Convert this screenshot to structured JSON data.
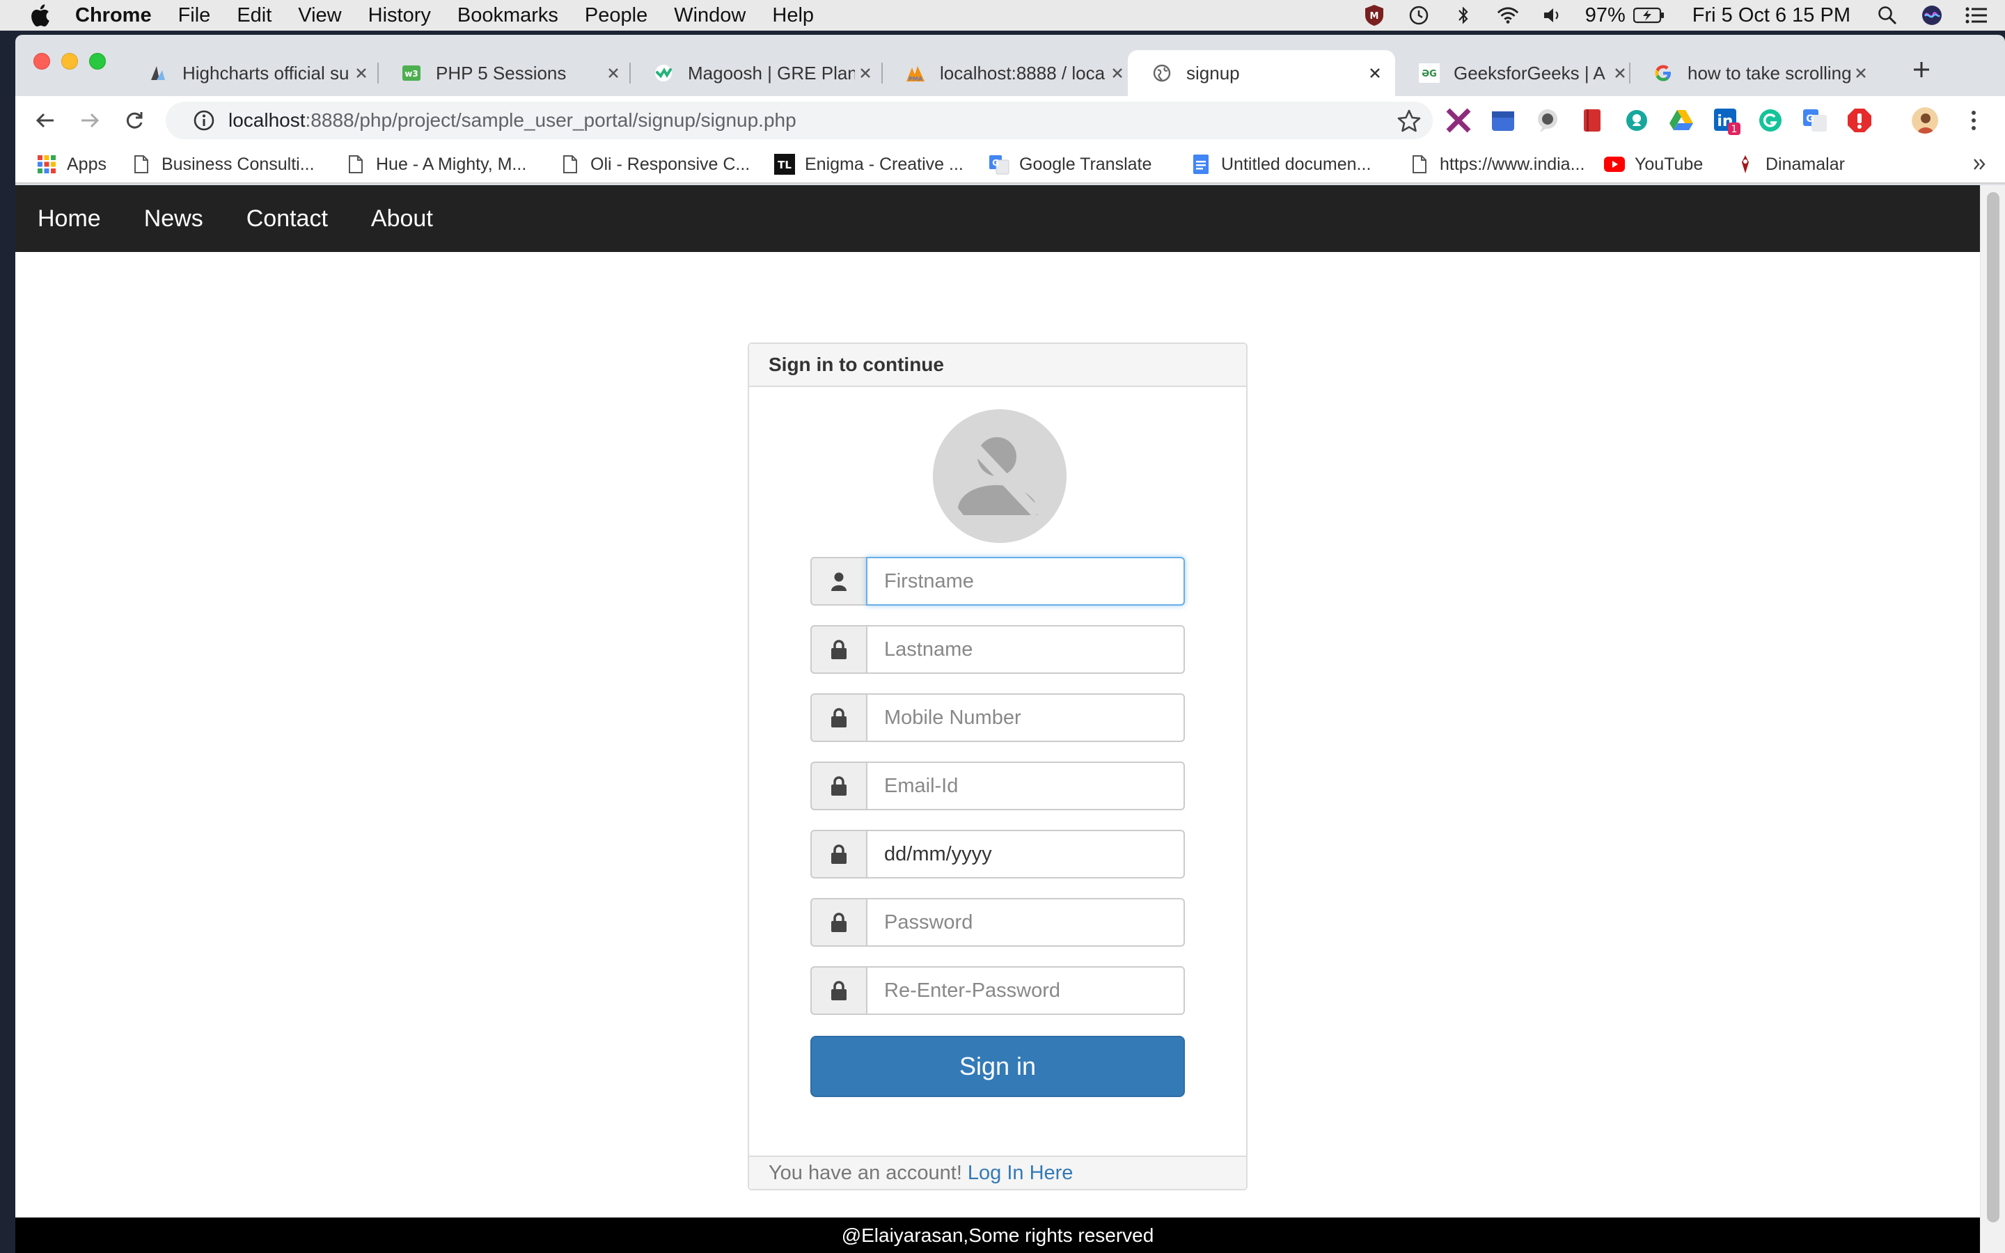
{
  "menubar": {
    "app": "Chrome",
    "items": [
      "File",
      "Edit",
      "View",
      "History",
      "Bookmarks",
      "People",
      "Window",
      "Help"
    ],
    "battery": "97%",
    "datetime": "Fri 5 Oct  6 15 PM"
  },
  "tabs": [
    {
      "title": "Highcharts official su",
      "favicon": "highcharts-icon",
      "active": false
    },
    {
      "title": "PHP 5 Sessions",
      "favicon": "w3schools-icon",
      "active": false
    },
    {
      "title": "Magoosh | GRE Plan",
      "favicon": "magoosh-icon",
      "active": false
    },
    {
      "title": "localhost:8888 / loca",
      "favicon": "phpmyadmin-icon",
      "active": false
    },
    {
      "title": "signup",
      "favicon": "globe-icon",
      "active": true
    },
    {
      "title": "GeeksforGeeks | A c",
      "favicon": "geeksforgeeks-icon",
      "active": false
    },
    {
      "title": "how to take scrolling",
      "favicon": "google-icon",
      "active": false
    }
  ],
  "address": {
    "host": "localhost",
    "path": ":8888/php/project/sample_user_portal/signup/signup.php"
  },
  "bookmarks": [
    {
      "label": "Apps",
      "icon": "apps-grid-icon"
    },
    {
      "label": "Business Consulti...",
      "icon": "page-icon"
    },
    {
      "label": "Hue - A Mighty, M...",
      "icon": "page-icon"
    },
    {
      "label": "Oli - Responsive C...",
      "icon": "page-icon"
    },
    {
      "label": "Enigma - Creative ...",
      "icon": "tl-logo-icon"
    },
    {
      "label": "Google Translate",
      "icon": "google-translate-icon"
    },
    {
      "label": "Untitled documen...",
      "icon": "google-docs-icon"
    },
    {
      "label": "https://www.india...",
      "icon": "page-icon"
    },
    {
      "label": "YouTube",
      "icon": "youtube-icon"
    },
    {
      "label": "Dinamalar",
      "icon": "dinamalar-icon"
    }
  ],
  "site_nav": [
    "Home",
    "News",
    "Contact",
    "About"
  ],
  "form": {
    "heading": "Sign in to continue",
    "fields": [
      {
        "placeholder": "Firstname",
        "icon": "user-icon"
      },
      {
        "placeholder": "Lastname",
        "icon": "lock-icon"
      },
      {
        "placeholder": "Mobile Number",
        "icon": "lock-icon"
      },
      {
        "placeholder": "Email-Id",
        "icon": "lock-icon"
      },
      {
        "placeholder": "dd/mm/yyyy",
        "icon": "lock-icon"
      },
      {
        "placeholder": "Password",
        "icon": "lock-icon"
      },
      {
        "placeholder": "Re-Enter-Password",
        "icon": "lock-icon"
      }
    ],
    "submit_label": "Sign in",
    "footer_text": "You have an account!",
    "footer_link": "Log In Here"
  },
  "site_footer": "@Elaiyarasan,Some rights reserved",
  "colors": {
    "primary": "#337ab7",
    "navbar": "#222222",
    "focus": "#66afe9"
  }
}
